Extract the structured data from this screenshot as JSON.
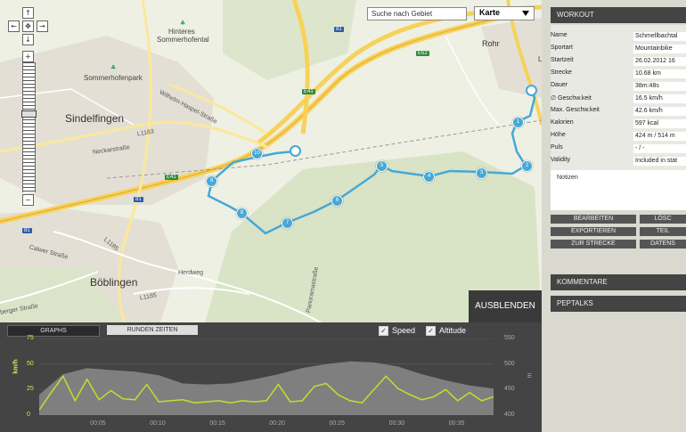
{
  "map": {
    "search_placeholder": "Suche nach Gebiet",
    "maptype": "Karte",
    "hide_button": "AUSBLENDEN",
    "labels": {
      "sindelfingen": "Sindelfingen",
      "boeblingen": "Böblingen",
      "rohr": "Rohr",
      "hinteres": "Hinteres",
      "sommerhofental": "Sommerhofental",
      "sommerhofenpark": "Sommerhofenpark",
      "wilhelm": "Wilhelm-Haspel-Straße",
      "neckarstr": "Neckarstraße",
      "l1183": "L1183",
      "l1185": "L1185",
      "l1185b": "L1185",
      "calwer": "Calwer Straße",
      "herdweg": "Herdweg",
      "panorama": "Panoramastraße",
      "berger": "berger Straße",
      "a81": "81",
      "a81b": "81",
      "a81c": "81",
      "e41": "E41",
      "e41b": "E41",
      "e52": "E52",
      "l": "L"
    },
    "markers": [
      "1",
      "2",
      "3",
      "4",
      "5",
      "6",
      "7",
      "8",
      "9",
      "10"
    ]
  },
  "nav": {
    "up": "↑",
    "down": "↓",
    "left": "←",
    "right": "→",
    "center": "✥",
    "plus": "+",
    "minus": "−"
  },
  "graph": {
    "tab_graphs": "GRAPHS",
    "tab_laps": "RUNDEN ZEITEN",
    "speed_label": "Speed",
    "altitude_label": "Altitude",
    "speed_unit": "km/h",
    "altitude_unit": "m",
    "x_ticks": [
      "00:05",
      "00:10",
      "00:15",
      "00:20",
      "00:25",
      "00:30",
      "00:35"
    ],
    "y_left_ticks": [
      "75",
      "50",
      "25",
      "0"
    ],
    "y_right_ticks": [
      "550",
      "500",
      "450",
      "400"
    ],
    "speed_color": "#c8dc2c",
    "altitude_color": "#8a8a8a",
    "chart_data": {
      "type": "line",
      "x_label": "",
      "series": [
        {
          "name": "Speed",
          "unit": "km/h",
          "ylim": [
            0,
            75
          ],
          "x_minutes": [
            0,
            1,
            2,
            3,
            4,
            5,
            6,
            7,
            8,
            9,
            10,
            11,
            12,
            13,
            14,
            15,
            16,
            17,
            18,
            19,
            20,
            21,
            22,
            23,
            24,
            25,
            26,
            27,
            28,
            29,
            30,
            31,
            32,
            33,
            34,
            35,
            36,
            37,
            38
          ],
          "values": [
            5,
            22,
            38,
            14,
            35,
            15,
            24,
            16,
            15,
            30,
            13,
            14,
            15,
            12,
            13,
            14,
            12,
            14,
            13,
            14,
            30,
            13,
            14,
            28,
            31,
            20,
            14,
            12,
            25,
            38,
            26,
            20,
            15,
            18,
            25,
            14,
            22,
            14,
            18
          ]
        },
        {
          "name": "Altitude",
          "unit": "m",
          "ylim": [
            400,
            550
          ],
          "x_minutes": [
            0,
            2,
            4,
            6,
            8,
            10,
            12,
            14,
            16,
            18,
            20,
            22,
            24,
            26,
            28,
            30,
            32,
            34,
            36,
            38
          ],
          "values": [
            440,
            480,
            492,
            488,
            485,
            478,
            462,
            460,
            462,
            470,
            480,
            492,
            500,
            505,
            503,
            495,
            480,
            468,
            458,
            452
          ]
        }
      ]
    }
  },
  "panel": {
    "workout_header": "WORKOUT",
    "rows": [
      {
        "k": "Name",
        "v": "Schmellbachtal"
      },
      {
        "k": "Sportart",
        "v": "Mountainbike"
      },
      {
        "k": "Startzeit",
        "v": "26.02.2012 16"
      },
      {
        "k": "Strecke",
        "v": "10.68 km"
      },
      {
        "k": "Dauer",
        "v": "38m:48s"
      },
      {
        "k": "∅ Geschw.keit",
        "v": "16.5 km/h"
      },
      {
        "k": "Max. Geschw.keit",
        "v": "42.6 km/h"
      },
      {
        "k": "Kalorien",
        "v": "597 kcal"
      },
      {
        "k": "Höhe",
        "v": "424 m / 514 m"
      },
      {
        "k": "Puls",
        "v": "- / -"
      },
      {
        "k": "Validity",
        "v": "Included in stat"
      }
    ],
    "notes_label": "Notizen",
    "buttons": {
      "edit": "BEARBEITEN",
      "delete": "LÖSC",
      "export": "EXPORTIEREN",
      "share": "TEIL",
      "route": "ZUR STRECKE",
      "data": "DATENS"
    },
    "comments_header": "KOMMENTARE",
    "peptalks_header": "PEPTALKS"
  },
  "colors": {
    "track": "#45a9d6",
    "road_yellow": "#f7d25a",
    "panel_dark": "#444444"
  }
}
